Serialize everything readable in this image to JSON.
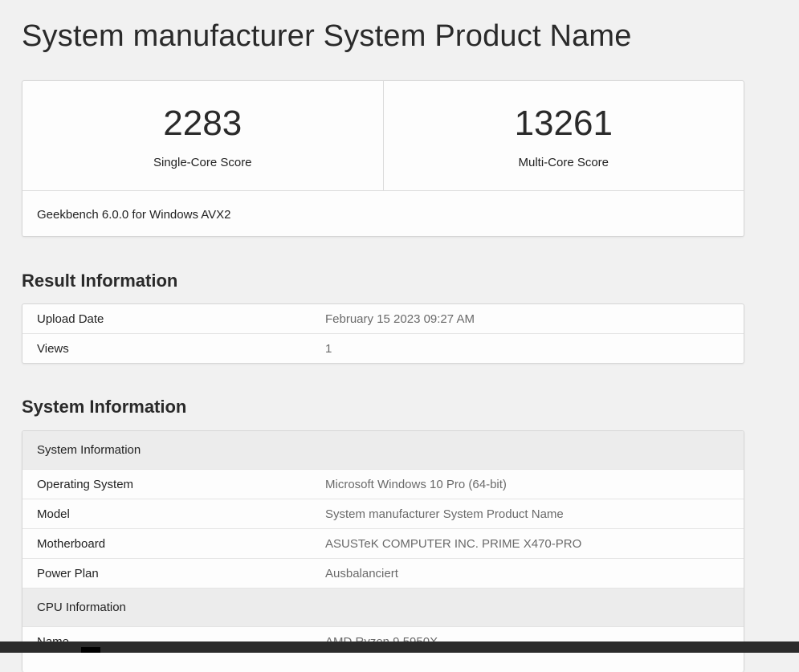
{
  "page": {
    "title": "System manufacturer System Product Name"
  },
  "scores": {
    "single_core": {
      "value": "2283",
      "label": "Single-Core Score"
    },
    "multi_core": {
      "value": "13261",
      "label": "Multi-Core Score"
    },
    "version": "Geekbench 6.0.0 for Windows AVX2"
  },
  "result_information": {
    "heading": "Result Information",
    "rows": [
      {
        "label": "Upload Date",
        "value": "February 15 2023 09:27 AM"
      },
      {
        "label": "Views",
        "value": "1"
      }
    ]
  },
  "system_information": {
    "heading": "System Information",
    "groups": [
      {
        "title": "System Information",
        "rows": [
          {
            "label": "Operating System",
            "value": "Microsoft Windows 10 Pro (64-bit)"
          },
          {
            "label": "Model",
            "value": "System manufacturer System Product Name"
          },
          {
            "label": "Motherboard",
            "value": "ASUSTeK COMPUTER INC. PRIME X470-PRO"
          },
          {
            "label": "Power Plan",
            "value": "Ausbalanciert"
          }
        ]
      },
      {
        "title": "CPU Information",
        "rows": [
          {
            "label": "Name",
            "value": "AMD Ryzen 9 5950X"
          }
        ]
      }
    ]
  }
}
